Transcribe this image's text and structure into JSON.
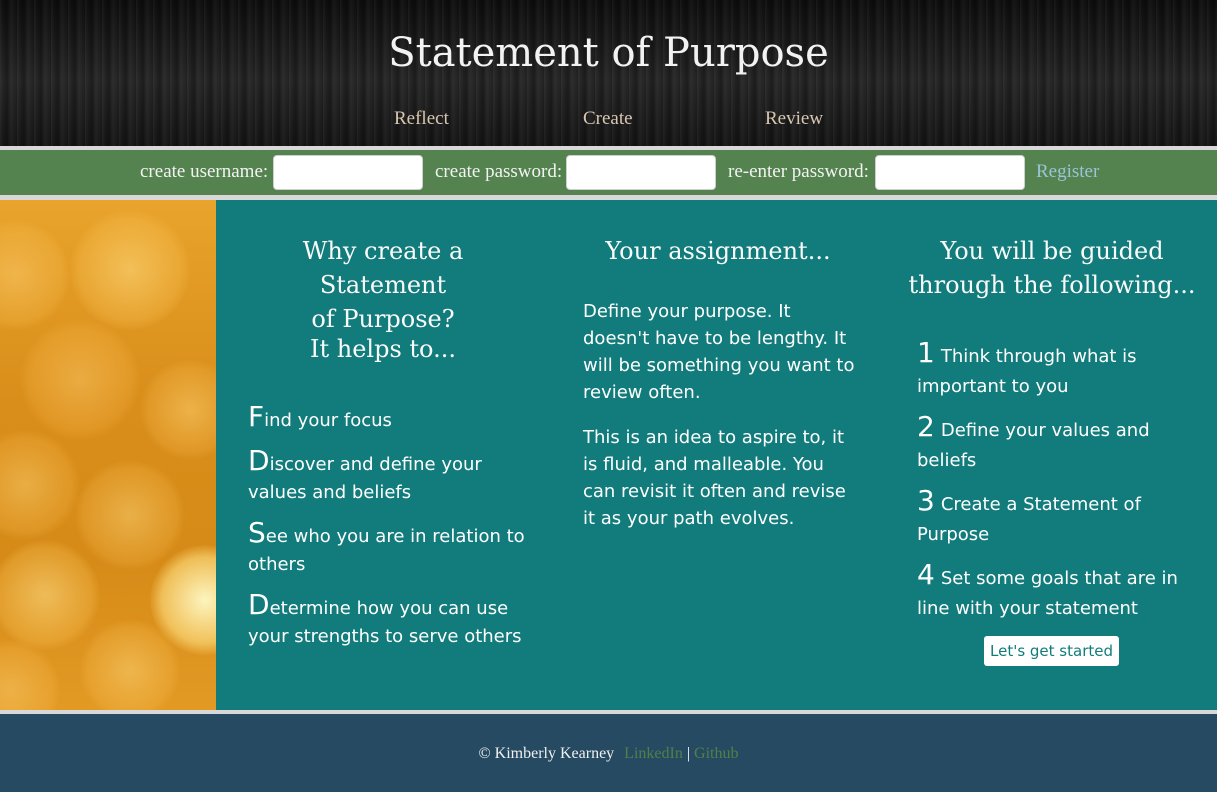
{
  "header": {
    "title": "Statement of Purpose",
    "nav": [
      "Reflect",
      "Create",
      "Review"
    ]
  },
  "register": {
    "username_label": "create username:",
    "password_label": "create password:",
    "reenter_label": "re-enter password:",
    "register_link": "Register",
    "username_value": "",
    "password_value": "",
    "reenter_value": ""
  },
  "why": {
    "heading_line1": "Why create a Statement",
    "heading_line2": "of Purpose?",
    "subheading": "It helps to...",
    "items": [
      {
        "initial": "F",
        "rest": "ind your focus"
      },
      {
        "initial": "D",
        "rest": "iscover and define your values and beliefs"
      },
      {
        "initial": "S",
        "rest": "ee who you are in relation to others"
      },
      {
        "initial": "D",
        "rest": "etermine how you can use your strengths to serve others"
      }
    ]
  },
  "assignment": {
    "heading": "Your assignment...",
    "paragraphs": [
      "Define your purpose. It doesn't have to be lengthy. It will be something you want to review often.",
      "This is an idea to aspire to, it is fluid, and malleable. You can revisit it often and revise it as your path evolves."
    ]
  },
  "guided": {
    "heading_line1": "You will be guided",
    "heading_line2": "through the following...",
    "steps": [
      {
        "num": "1",
        "text": "Think through what is important to you"
      },
      {
        "num": "2",
        "text": "Define your values and beliefs"
      },
      {
        "num": "3",
        "text": "Create a Statement of Purpose"
      },
      {
        "num": "4",
        "text": "Set some goals that are in line with your statement"
      }
    ],
    "button": "Let's get started"
  },
  "footer": {
    "copyright": "© Kimberly Kearney",
    "linkedin": "LinkedIn",
    "separator": "|",
    "github": "Github"
  },
  "colors": {
    "header_bg": "#1a1a1a",
    "register_bar": "#54834f",
    "main_teal": "#117c7b",
    "footer_bg": "#274a63",
    "nav_text": "#d9c6b0",
    "register_link": "#9cc3d8",
    "footer_link": "#4f8049"
  }
}
